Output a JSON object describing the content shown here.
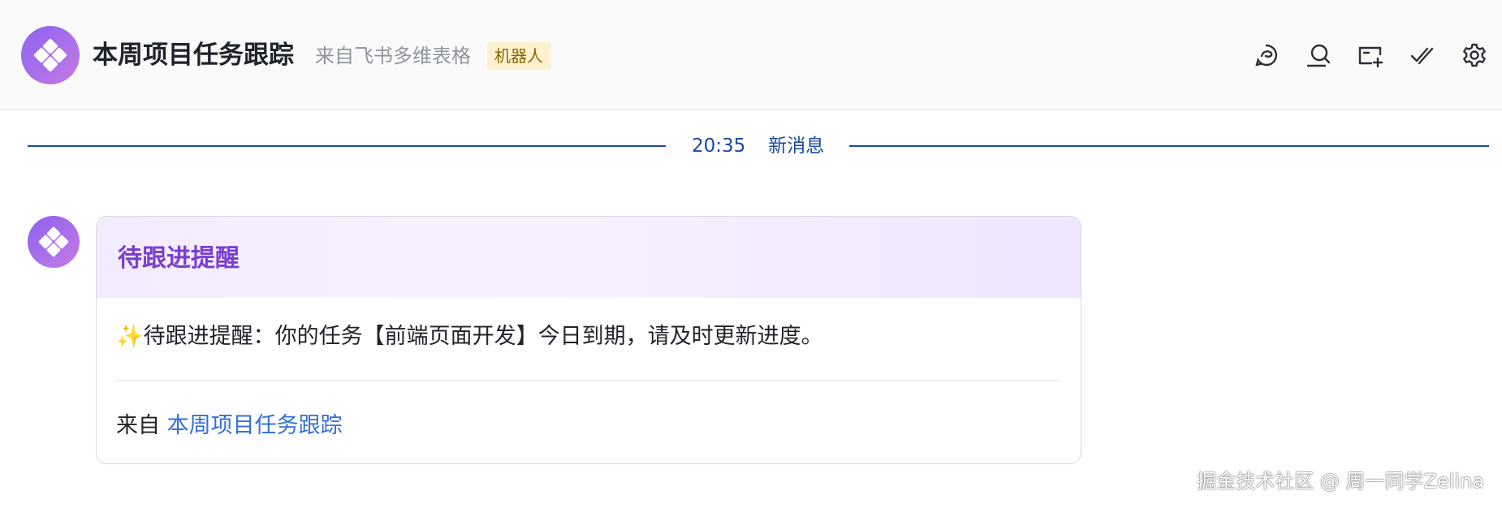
{
  "header": {
    "title": "本周项目任务跟踪",
    "source": "来自飞书多维表格",
    "badge": "机器人",
    "avatar_icon": "base-app-logo-icon",
    "toolbar": [
      {
        "name": "message-history-icon"
      },
      {
        "name": "search-chat-icon"
      },
      {
        "name": "add-tab-icon"
      },
      {
        "name": "checkmark-done-icon"
      },
      {
        "name": "settings-gear-icon"
      }
    ]
  },
  "divider": {
    "time": "20:35",
    "label": "新消息"
  },
  "message": {
    "sender_avatar_icon": "base-app-logo-icon",
    "card": {
      "title": "待跟进提醒",
      "emoji": "✨",
      "body": "待跟进提醒：你的任务【前端页面开发】今日到期，请及时更新进度。",
      "footer_prefix": "来自",
      "footer_link": "本周项目任务跟踪"
    }
  },
  "watermark": "掘金技术社区 @ 周一同学Zelina",
  "colors": {
    "accent_purple": "#7a3fd0",
    "divider_blue": "#1a4a9c",
    "link_blue": "#3370d6",
    "badge_bg": "#fdf1cf",
    "badge_text": "#8a6500"
  }
}
